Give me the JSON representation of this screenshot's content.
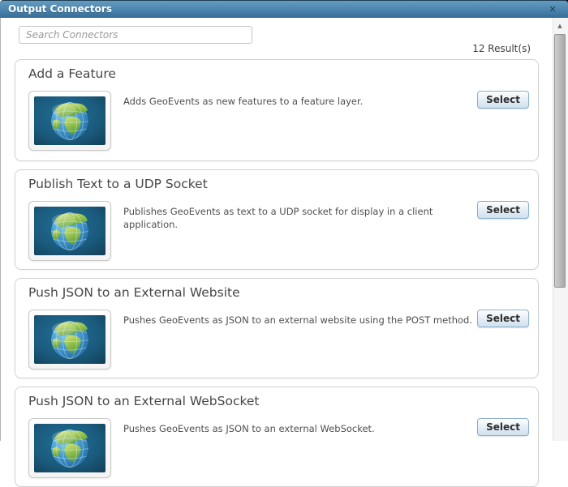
{
  "window": {
    "title": "Output Connectors"
  },
  "icons": {
    "close": "✕",
    "scroll_up": "▲"
  },
  "search": {
    "placeholder": "Search Connectors"
  },
  "results_count": "12 Result(s)",
  "colors": {
    "titlebar_top": "#649bc0",
    "titlebar_bottom": "#376d97",
    "card_border": "#d2d2d2",
    "select_border": "#8bafcc",
    "select_fill": "#cfe0ee",
    "thumb_bg_blue": "#1d6285",
    "globe_ocean": "#3f9ad0",
    "globe_land": "#8fbf4a"
  },
  "connectors": [
    {
      "title": "Add a Feature",
      "description": "Adds GeoEvents as new features to a feature layer.",
      "select_label": "Select"
    },
    {
      "title": "Publish Text to a UDP Socket",
      "description": "Publishes GeoEvents as text to a UDP socket for display in a client application.",
      "select_label": "Select"
    },
    {
      "title": "Push JSON to an External Website",
      "description": "Pushes GeoEvents as JSON to an external website using the POST method.",
      "select_label": "Select"
    },
    {
      "title": "Push JSON to an External WebSocket",
      "description": "Pushes GeoEvents as JSON to an external WebSocket.",
      "select_label": "Select"
    }
  ]
}
